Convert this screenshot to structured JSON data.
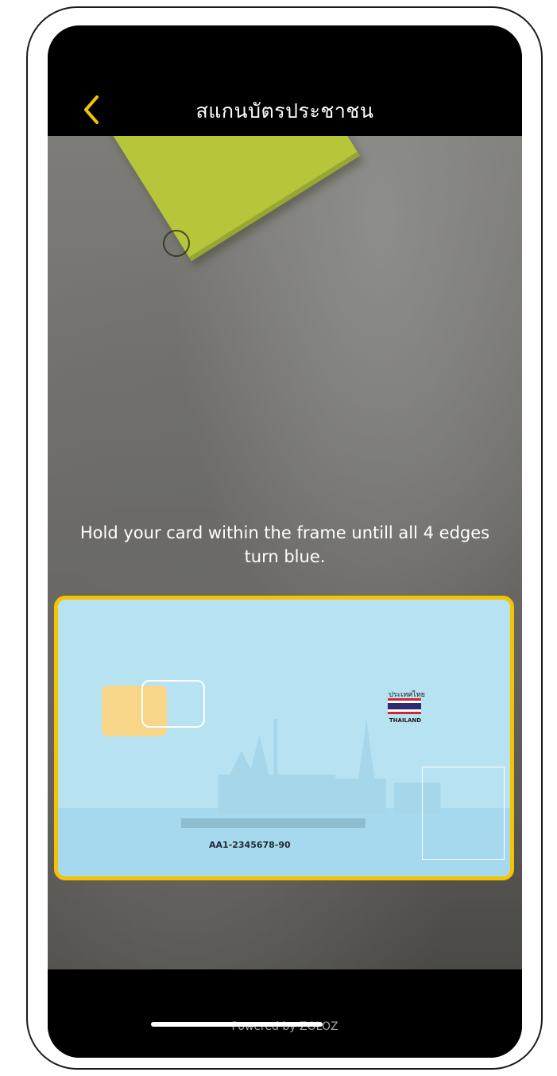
{
  "nav": {
    "title": "สแกนบัตรประชาชน",
    "back_icon": "chevron-left-icon",
    "accent_color": "#f5c400"
  },
  "camera": {
    "instruction": "Hold your card within the frame untill all 4 edges turn blue."
  },
  "card": {
    "country_thai": "ประเทศไทย",
    "country_en": "THAILAND",
    "number": "AA1-2345678-90",
    "frame_color": "#f5c400",
    "card_color": "#b6e2f2"
  },
  "footer": {
    "powered_by": "Powered by ZOLOZ"
  }
}
